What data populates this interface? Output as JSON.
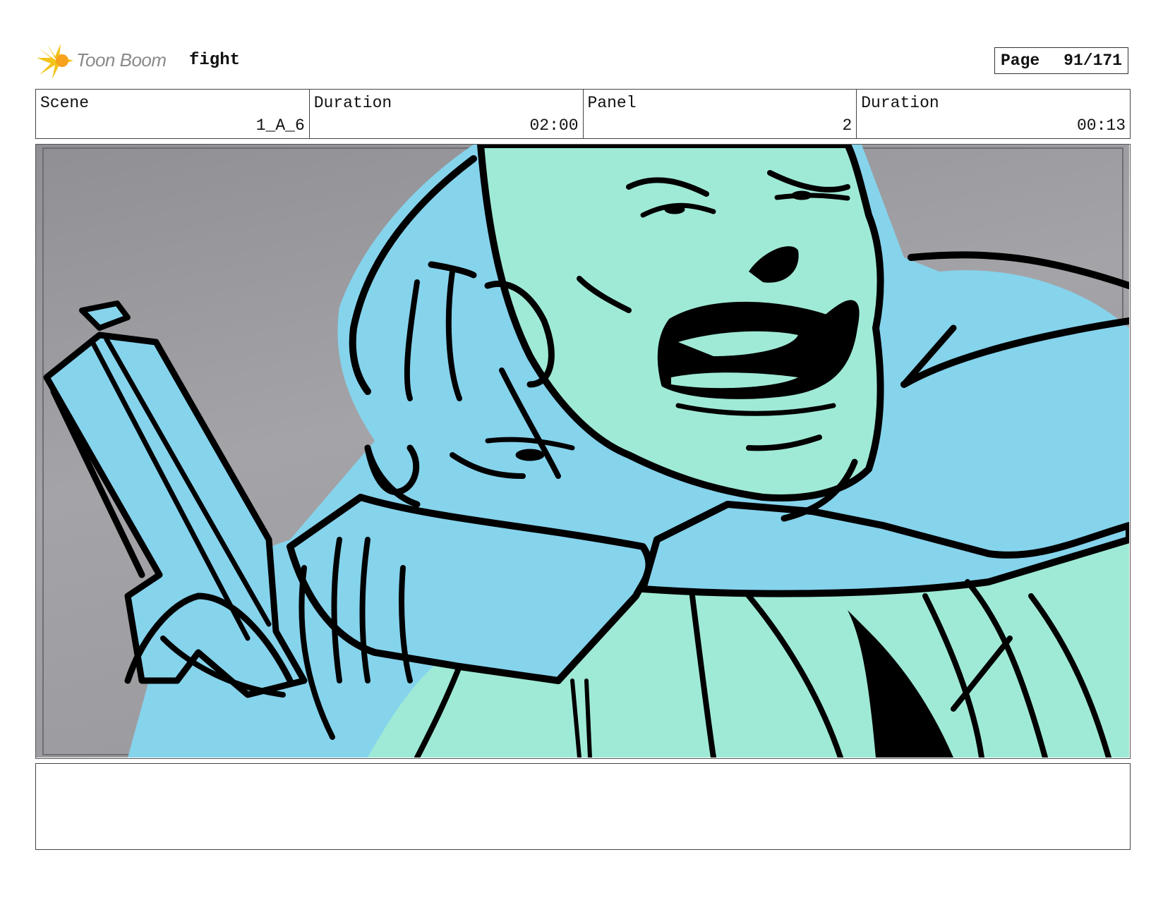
{
  "header": {
    "brand": "Toon Boom",
    "project": "fight",
    "page_label": "Page",
    "page_number": "91/171"
  },
  "info": {
    "scene_label": "Scene",
    "scene_value": "1_A_6",
    "scene_duration_label": "Duration",
    "scene_duration_value": "02:00",
    "panel_label": "Panel",
    "panel_value": "2",
    "panel_duration_label": "Duration",
    "panel_duration_value": "00:13"
  },
  "colors": {
    "background_gray": "#a2a2a6",
    "character_blue": "#86d3ec",
    "skin_green": "#9fead6",
    "ink": "#000000"
  },
  "notes": ""
}
